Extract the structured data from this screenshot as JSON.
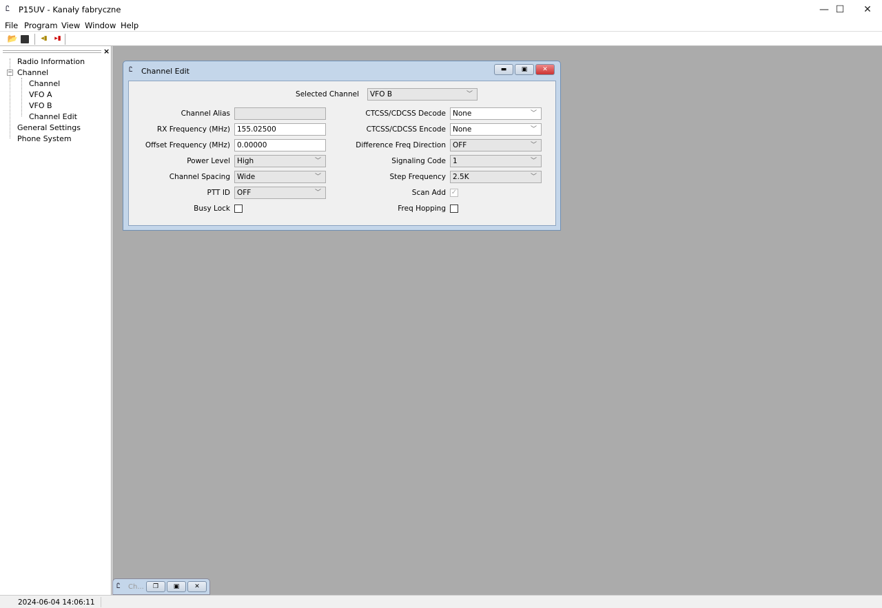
{
  "window": {
    "title": "P15UV - Kanały fabryczne",
    "min": "—",
    "max": "☐",
    "close": "✕"
  },
  "menu": [
    "File",
    "Program",
    "View",
    "Window",
    "Help"
  ],
  "toolbar": [
    {
      "icon": "open-folder-icon"
    },
    {
      "icon": "save-icon"
    },
    {
      "icon": "read-from-radio-icon"
    },
    {
      "icon": "write-to-radio-icon"
    }
  ],
  "sidebar": {
    "close": "×",
    "items": {
      "radio_info": "Radio Information",
      "channel": "Channel",
      "channel_child": "Channel",
      "vfo_a": "VFO A",
      "vfo_b": "VFO B",
      "channel_edit": "Channel Edit",
      "general": "General Settings",
      "phone": "Phone System"
    },
    "expander": "−"
  },
  "dialog": {
    "title": "Channel Edit",
    "selected_channel_label": "Selected Channel",
    "selected_channel": "VFO B",
    "left": [
      {
        "label": "Channel Alias",
        "value": "",
        "type": "text-disabled"
      },
      {
        "label": "RX Frequency (MHz)",
        "value": "155.02500",
        "type": "text"
      },
      {
        "label": "Offset Frequency (MHz)",
        "value": "0.00000",
        "type": "text"
      },
      {
        "label": "Power Level",
        "value": "High",
        "type": "select"
      },
      {
        "label": "Channel Spacing",
        "value": "Wide",
        "type": "select"
      },
      {
        "label": "PTT ID",
        "value": "OFF",
        "type": "select"
      },
      {
        "label": "Busy Lock",
        "value": "unchecked",
        "type": "checkbox"
      }
    ],
    "right": [
      {
        "label": "CTCSS/CDCSS Decode",
        "value": "None",
        "type": "select-white"
      },
      {
        "label": "CTCSS/CDCSS Encode",
        "value": "None",
        "type": "select-white"
      },
      {
        "label": "Difference Freq Direction",
        "value": "OFF",
        "type": "select"
      },
      {
        "label": "Signaling Code",
        "value": "1",
        "type": "select"
      },
      {
        "label": "Step Frequency",
        "value": "2.5K",
        "type": "select"
      },
      {
        "label": "Scan Add",
        "value": "checked-disabled",
        "type": "checkbox"
      },
      {
        "label": "Freq Hopping",
        "value": "unchecked",
        "type": "checkbox"
      }
    ]
  },
  "minimized": {
    "title": "Ch..."
  },
  "status": {
    "datetime": "2024-06-04 14:06:11"
  }
}
